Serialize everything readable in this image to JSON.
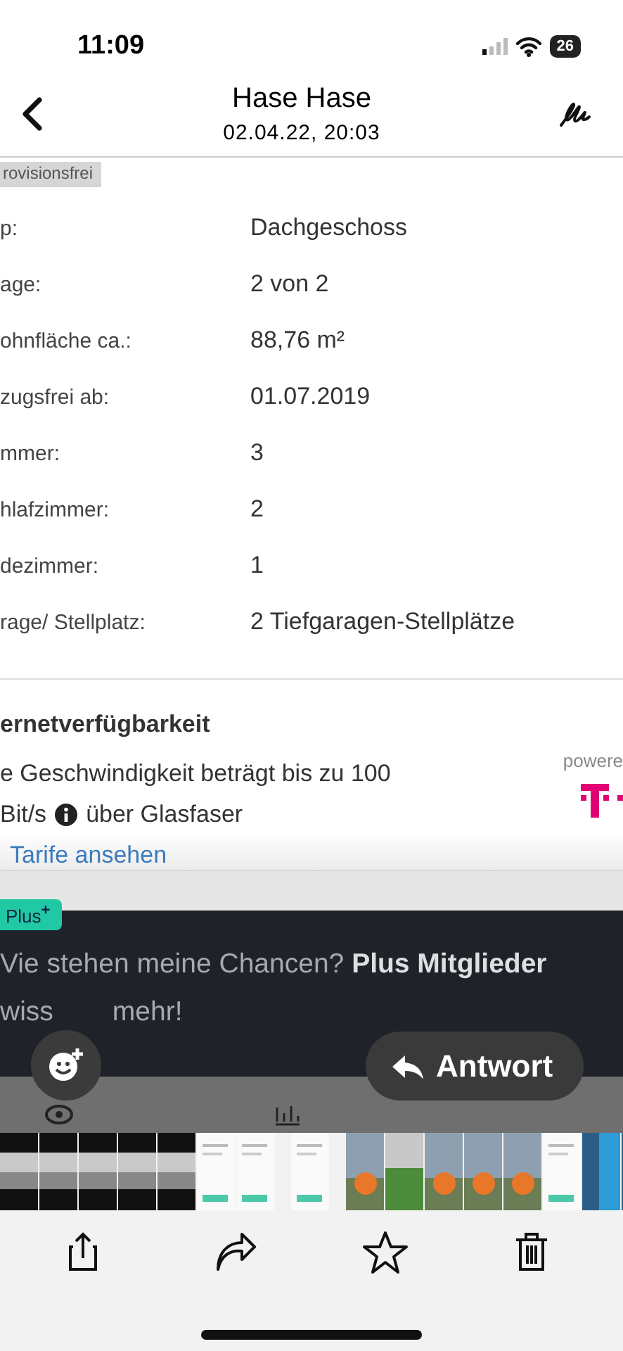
{
  "status_bar": {
    "time": "11:09",
    "battery": "26"
  },
  "header": {
    "title": "Hase Hase",
    "subtitle": "02.04.22, 20:03"
  },
  "listing": {
    "tag": "rovisionsfrei",
    "details": [
      {
        "label": "p:",
        "value": "Dachgeschoss"
      },
      {
        "label": "age:",
        "value": "2 von 2"
      },
      {
        "label": "ohnfläche ca.:",
        "value": "88,76 m²"
      },
      {
        "label": "zugsfrei ab:",
        "value": "01.07.2019"
      },
      {
        "label": "mmer:",
        "value": "3"
      },
      {
        "label": "hlafzimmer:",
        "value": "2"
      },
      {
        "label": "dezimmer:",
        "value": "1"
      },
      {
        "label": "rage/ Stellplatz:",
        "value": "2 Tiefgaragen-Stellplätze"
      }
    ]
  },
  "internet": {
    "title": "ernetverfügbarkeit",
    "line_1": "e Geschwindigkeit beträgt bis zu 100",
    "speed": "Bit/s",
    "medium": "über Glasfaser",
    "link": "Tarife ansehen",
    "powered": "powere"
  },
  "plus_banner": {
    "badge": "Plus$^{+}$",
    "line_1": "Vie stehen meine Chancen? **Plus Mitglieder**",
    "line_2_start": "wiss",
    "line_2_end": "mehr!"
  },
  "reply_button": {
    "label": "Antwort"
  }
}
